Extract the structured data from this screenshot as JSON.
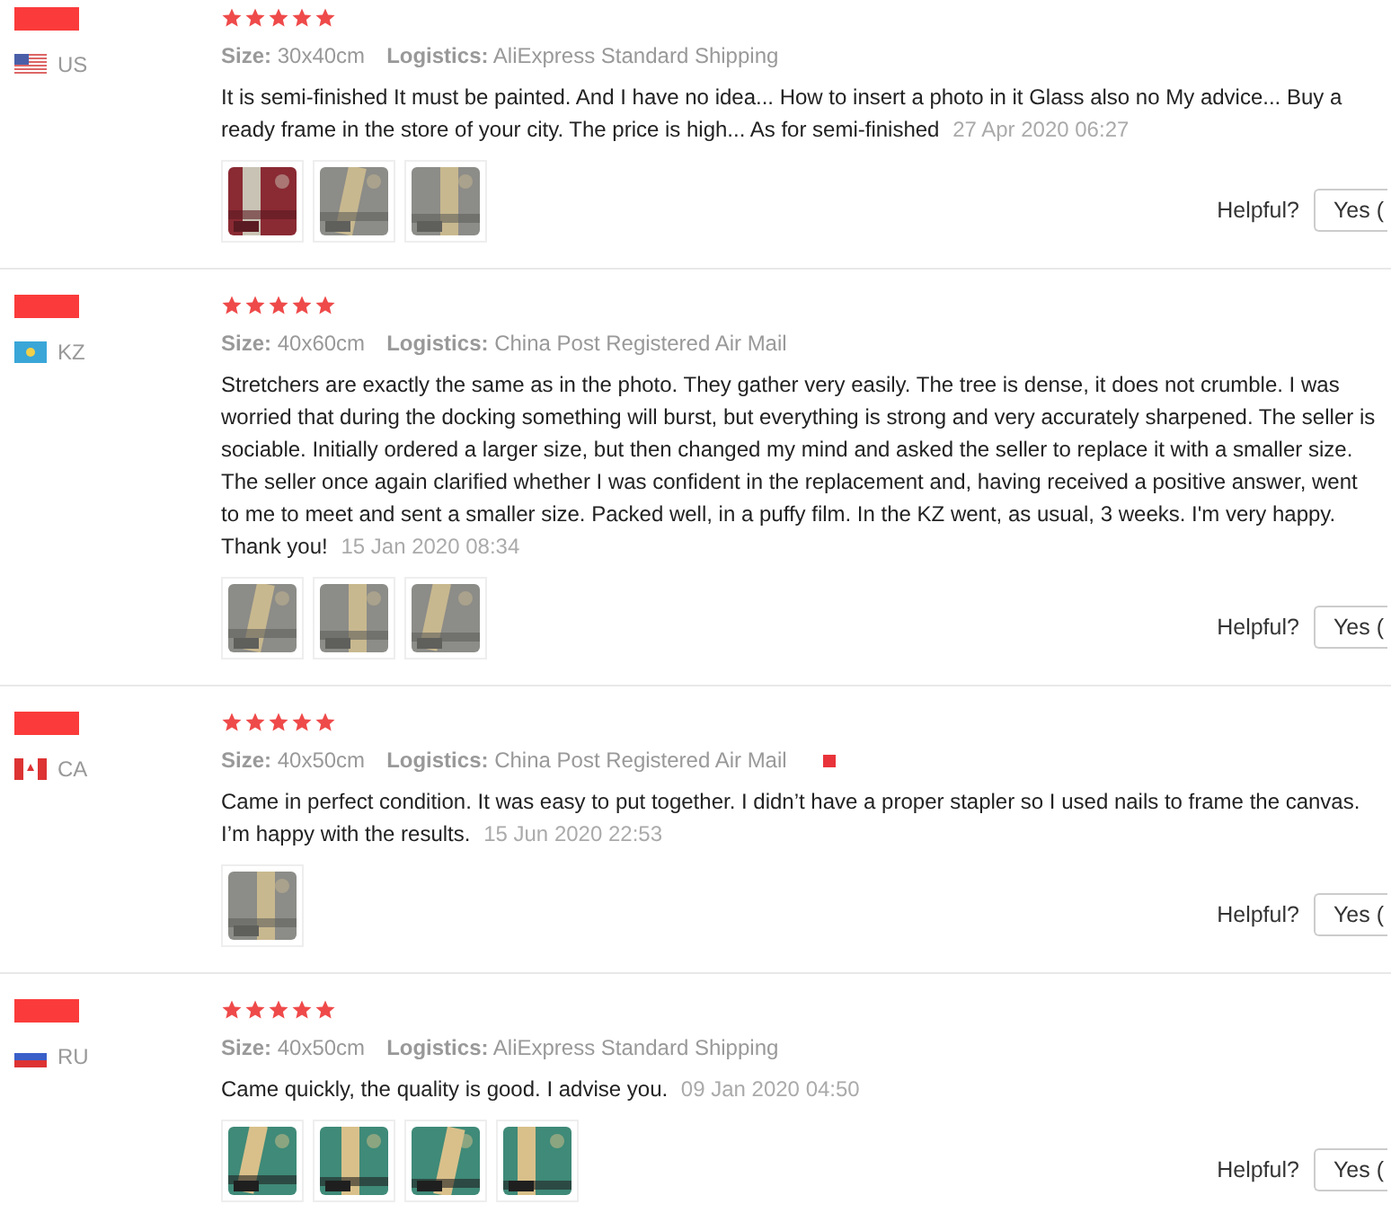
{
  "reviews": [
    {
      "country": "US",
      "stars": 5,
      "size_label": "Size:",
      "size": "30x40cm",
      "logistics_label": "Logistics:",
      "logistics": "AliExpress Standard Shipping",
      "text": "It is semi-finished It must be painted. And I have no idea... How to insert a photo in it Glass also no My advice... Buy a ready frame in the store of your city. The price is high... As for semi-finished",
      "date": "27 Apr 2020 06:27",
      "photos": [
        {
          "kind": "picture"
        },
        {
          "kind": "picture"
        },
        {
          "kind": "picture"
        }
      ],
      "helpful": "Helpful?",
      "yes": "Yes (",
      "marker": false
    },
    {
      "country": "KZ",
      "stars": 5,
      "size_label": "Size:",
      "size": "40x60cm",
      "logistics_label": "Logistics:",
      "logistics": "China Post Registered Air Mail",
      "text": "Stretchers are exactly the same as in the photo. They gather very easily. The tree is dense, it does not crumble. I was worried that during the docking something will burst, but everything is strong and very accurately sharpened. The seller is sociable. Initially ordered a larger size, but then changed my mind and asked the seller to replace it with a smaller size. The seller once again clarified whether I was confident in the replacement and, having received a positive answer, went to me to meet and sent a smaller size. Packed well, in a puffy film. In the KZ went, as usual, 3 weeks. I'm very happy. Thank you!",
      "date": "15 Jan 2020 08:34",
      "photos": [
        {
          "kind": "picture"
        },
        {
          "kind": "picture"
        },
        {
          "kind": "picture"
        }
      ],
      "helpful": "Helpful?",
      "yes": "Yes (",
      "marker": false
    },
    {
      "country": "CA",
      "stars": 5,
      "size_label": "Size:",
      "size": "40x50cm",
      "logistics_label": "Logistics:",
      "logistics": "China Post Registered Air Mail",
      "text": "Came in perfect condition. It was easy to put together. I didn’t have a proper stapler so I used nails to frame the canvas. I’m happy with the results.",
      "date": "15 Jun 2020 22:53",
      "photos": [
        {
          "kind": "picture"
        }
      ],
      "helpful": "Helpful?",
      "yes": "Yes (",
      "marker": true
    },
    {
      "country": "RU",
      "stars": 5,
      "size_label": "Size:",
      "size": "40x50cm",
      "logistics_label": "Logistics:",
      "logistics": "AliExpress Standard Shipping",
      "text": "Came quickly, the quality is good. I advise you.",
      "date": "09 Jan 2020 04:50",
      "photos": [
        {
          "kind": "picture"
        },
        {
          "kind": "picture"
        },
        {
          "kind": "picture"
        },
        {
          "kind": "picture"
        }
      ],
      "helpful": "Helpful?",
      "yes": "Yes (",
      "marker": false
    }
  ]
}
